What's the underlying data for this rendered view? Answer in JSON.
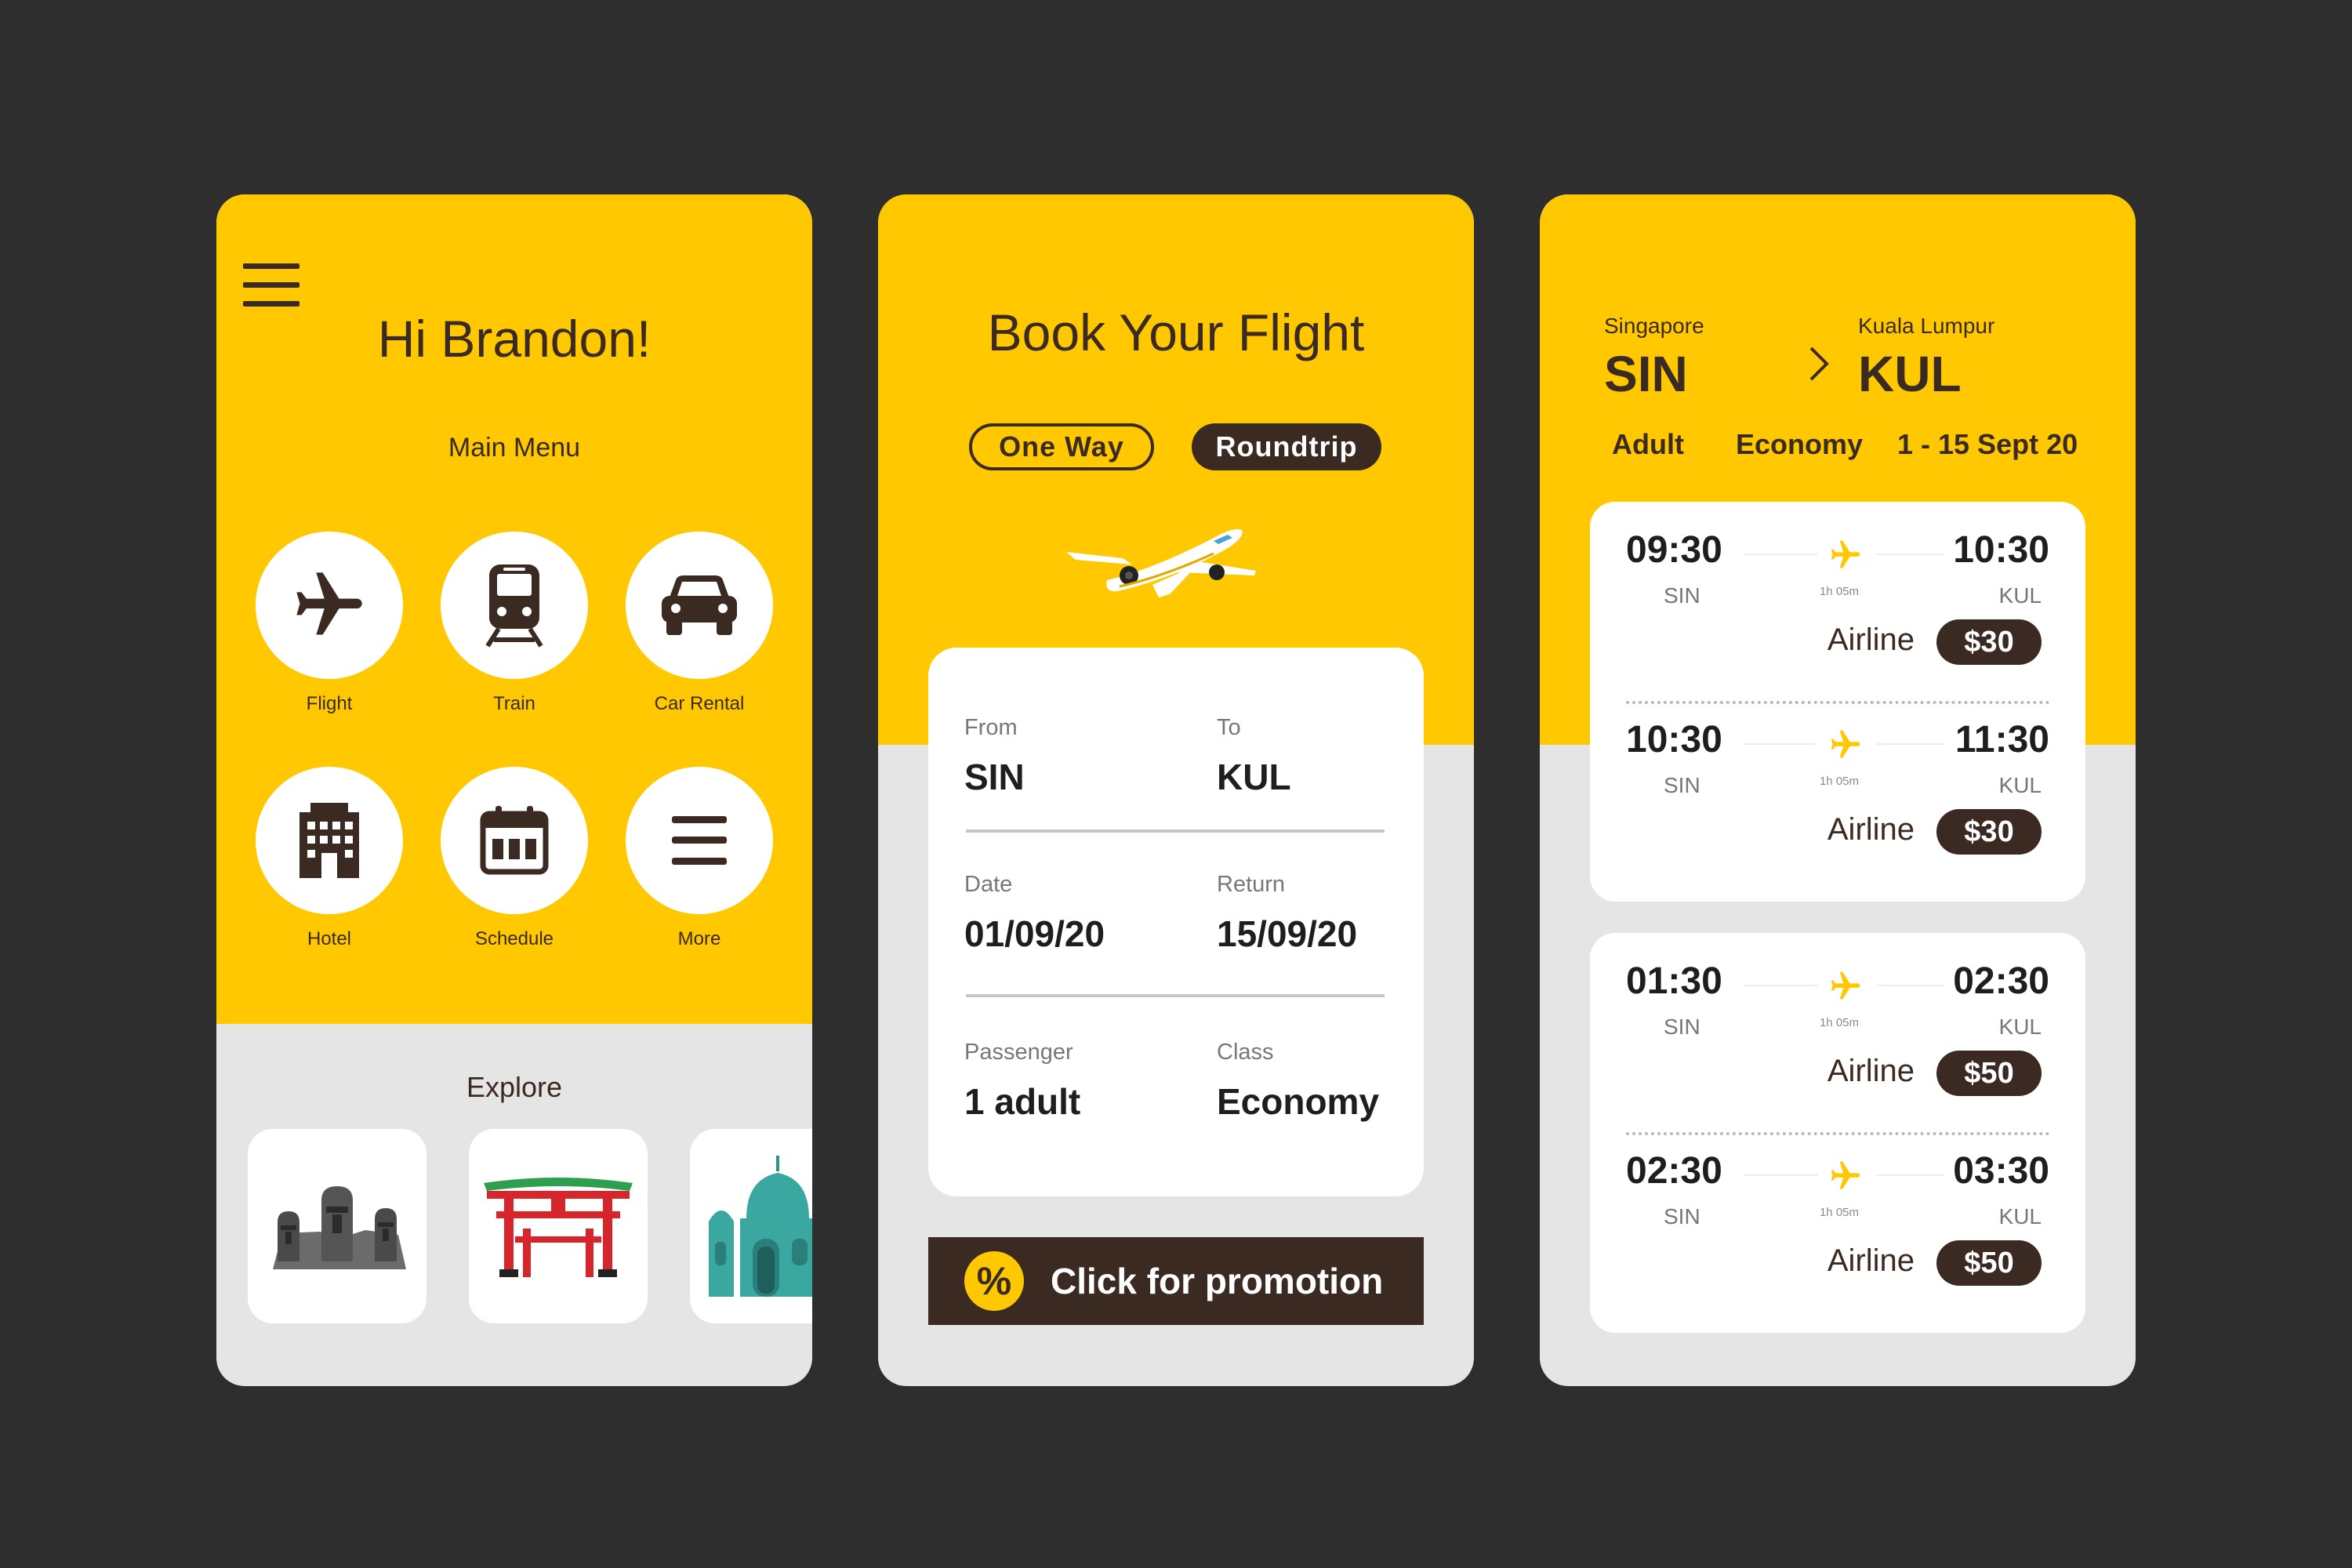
{
  "colors": {
    "background": "#2e2e2e",
    "accent": "#ffc800",
    "dark": "#3b2a22",
    "panel": "#e5e5e6",
    "card": "#ffffff"
  },
  "home": {
    "greeting": "Hi Brandon!",
    "main_menu_title": "Main Menu",
    "menu_items": [
      {
        "label": "Flight",
        "icon": "airplane-icon"
      },
      {
        "label": "Train",
        "icon": "train-icon"
      },
      {
        "label": "Car Rental",
        "icon": "car-icon"
      },
      {
        "label": "Hotel",
        "icon": "hotel-building-icon"
      },
      {
        "label": "Schedule",
        "icon": "calendar-icon"
      },
      {
        "label": "More",
        "icon": "menu-lines-icon"
      }
    ],
    "explore_title": "Explore",
    "explore_cards": [
      {
        "icon": "moai-statues-icon"
      },
      {
        "icon": "torii-gate-icon"
      },
      {
        "icon": "mosque-icon"
      }
    ]
  },
  "booking": {
    "title": "Book Your Flight",
    "trip_options": [
      "One Way",
      "Roundtrip"
    ],
    "selected_trip": "Roundtrip",
    "from_label": "From",
    "from_value": "SIN",
    "to_label": "To",
    "to_value": "KUL",
    "date_label": "Date",
    "date_value": "01/09/20",
    "return_label": "Return",
    "return_value": "15/09/20",
    "passenger_label": "Passenger",
    "passenger_value": "1 adult",
    "class_label": "Class",
    "class_value": "Economy",
    "promo_badge": "%",
    "promo_text": "Click for promotion"
  },
  "results": {
    "origin_city": "Singapore",
    "origin_code": "SIN",
    "dest_city": "Kuala Lumpur",
    "dest_code": "KUL",
    "passenger": "Adult",
    "cabin": "Economy",
    "dates": "1 - 15 Sept 20",
    "flights": [
      {
        "dep": "09:30",
        "arr": "10:30",
        "from": "SIN",
        "to": "KUL",
        "duration": "1h 05m",
        "airline": "Airline",
        "price": "$30"
      },
      {
        "dep": "10:30",
        "arr": "11:30",
        "from": "SIN",
        "to": "KUL",
        "duration": "1h 05m",
        "airline": "Airline",
        "price": "$30"
      },
      {
        "dep": "01:30",
        "arr": "02:30",
        "from": "SIN",
        "to": "KUL",
        "duration": "1h 05m",
        "airline": "Airline",
        "price": "$50"
      },
      {
        "dep": "02:30",
        "arr": "03:30",
        "from": "SIN",
        "to": "KUL",
        "duration": "1h 05m",
        "airline": "Airline",
        "price": "$50"
      }
    ]
  }
}
